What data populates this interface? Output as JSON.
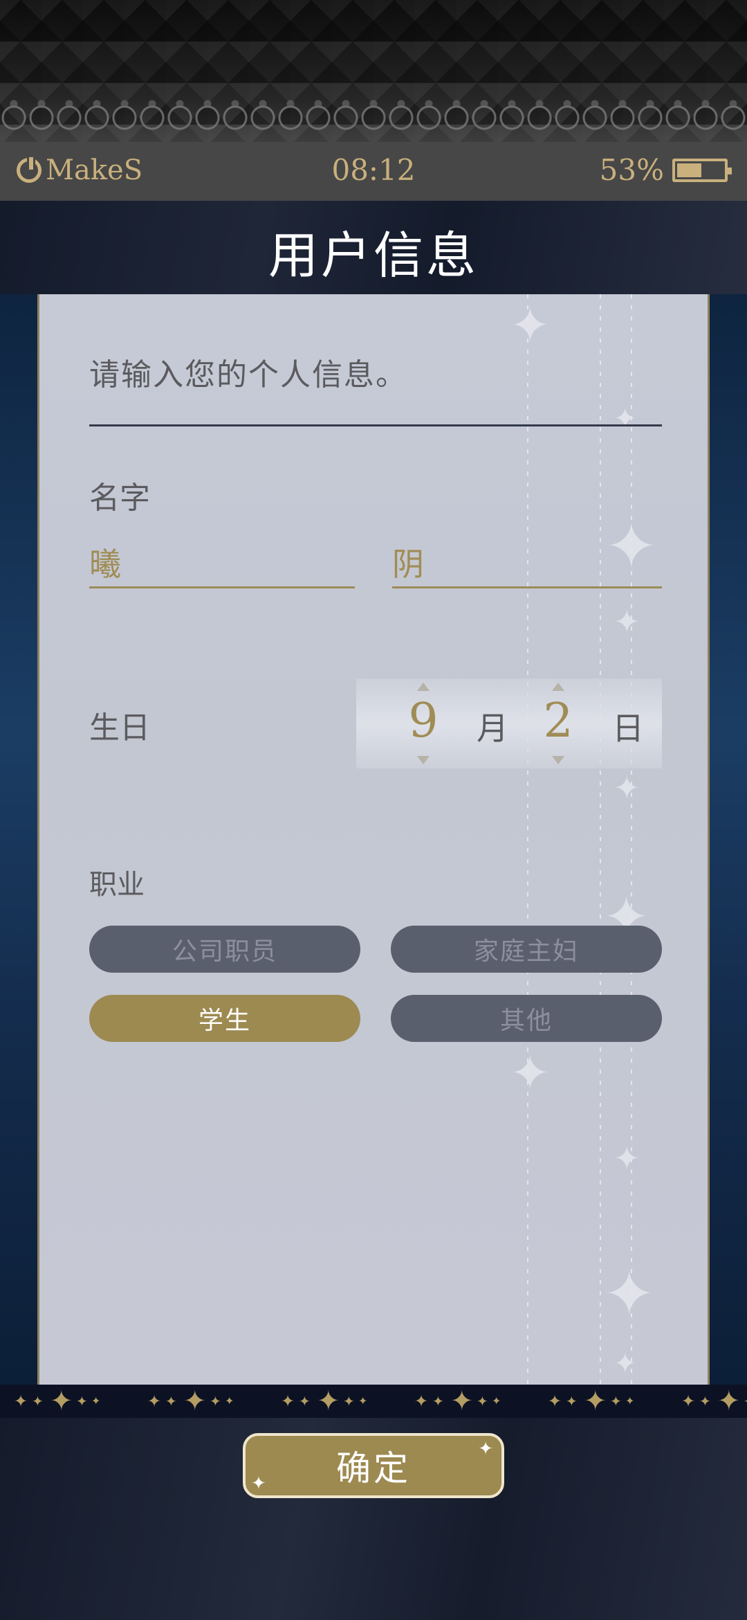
{
  "status_bar": {
    "brand": "MakeS",
    "time": "08:12",
    "battery_text": "53%",
    "battery_level": 0.53
  },
  "header": {
    "title": "用户信息"
  },
  "form": {
    "intro": "请输入您的个人信息。",
    "name_label": "名字",
    "last_name_value": "曦",
    "first_name_value": "阴",
    "birthday_label": "生日",
    "birthday_month": "9",
    "month_unit": "月",
    "birthday_day": "2",
    "day_unit": "日",
    "occupation_label": "职业",
    "occupations": [
      {
        "label": "公司职员",
        "selected": false
      },
      {
        "label": "家庭主妇",
        "selected": false
      },
      {
        "label": "学生",
        "selected": true
      },
      {
        "label": "其他",
        "selected": false
      }
    ]
  },
  "confirm_button": "确定",
  "colors": {
    "accent_gold": "#9d8a51",
    "text_gold": "#a08c55",
    "unselected_button": "#5a5f6e",
    "card_bg": "#c6cad6"
  }
}
